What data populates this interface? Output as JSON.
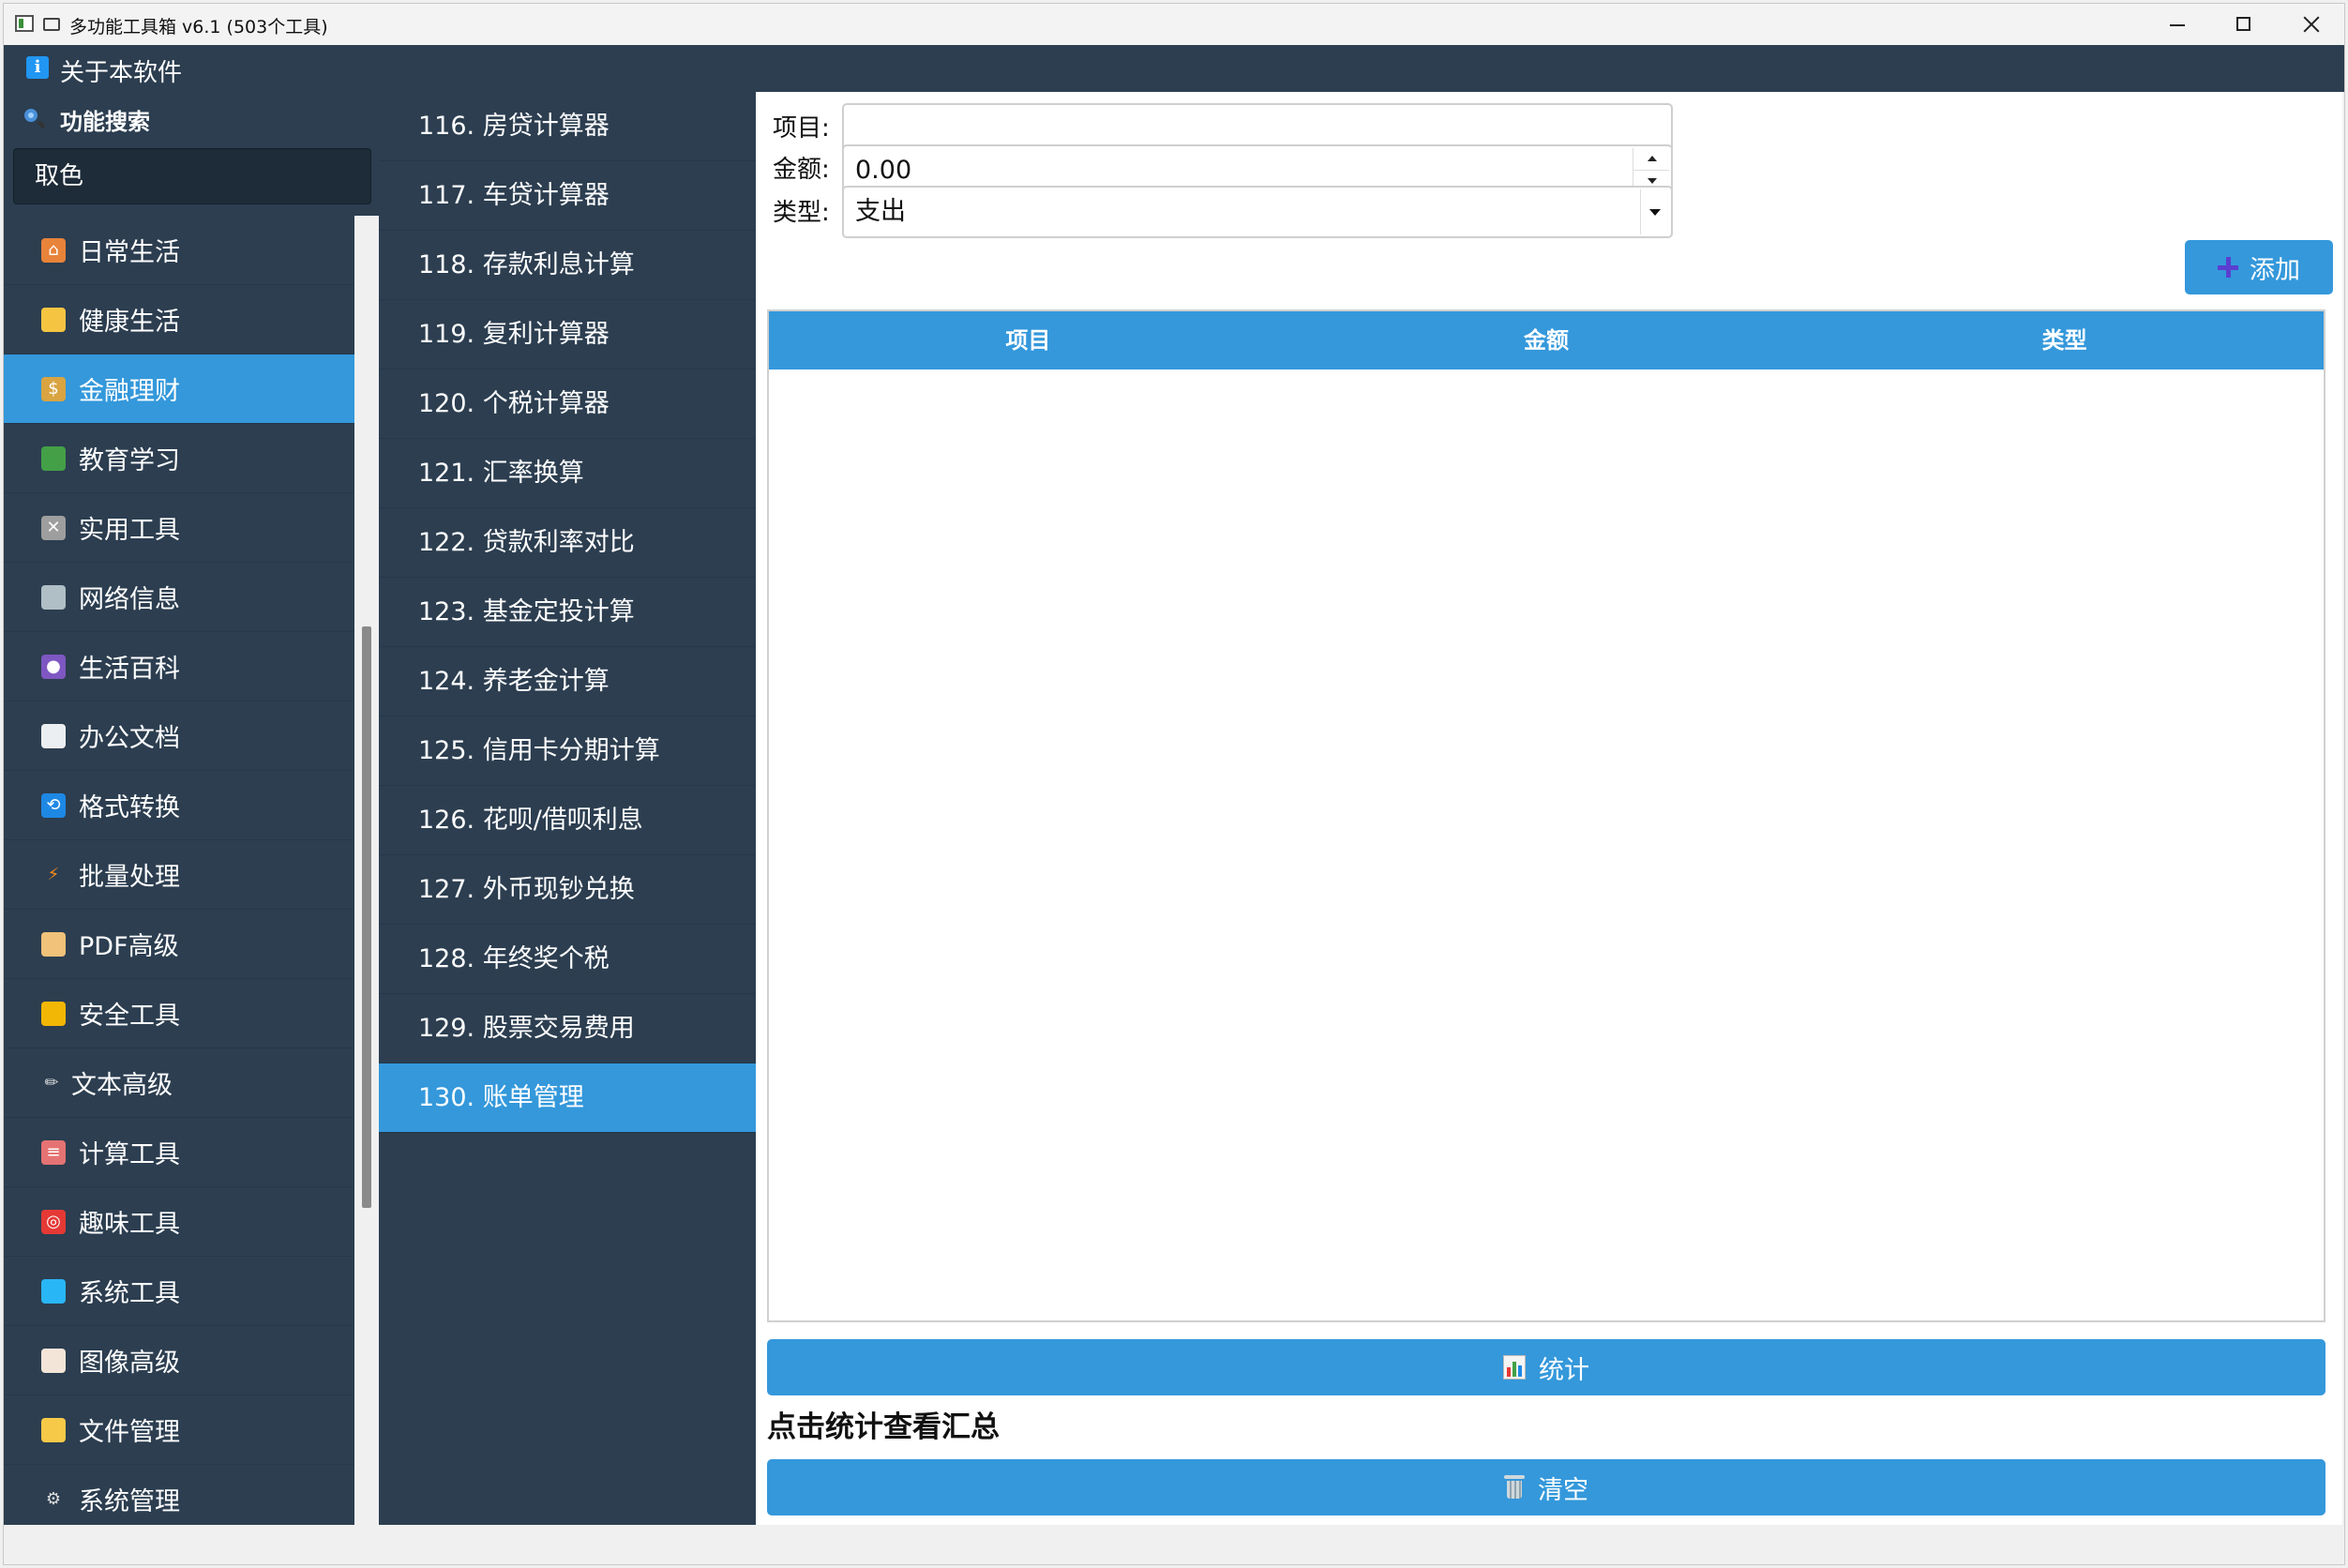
{
  "window": {
    "title": "多功能工具箱 v6.1 (503个工具)"
  },
  "menu": {
    "about": "关于本软件"
  },
  "search": {
    "label": "功能搜索",
    "value": "取色"
  },
  "categories": [
    {
      "label": "日常生活",
      "icon": "house-icon"
    },
    {
      "label": "健康生活",
      "icon": "flexed-arm-icon"
    },
    {
      "label": "金融理财",
      "icon": "money-bag-icon",
      "active": true
    },
    {
      "label": "教育学习",
      "icon": "books-icon"
    },
    {
      "label": "实用工具",
      "icon": "tools-icon"
    },
    {
      "label": "网络信息",
      "icon": "satellite-icon"
    },
    {
      "label": "生活百科",
      "icon": "bubble-icon"
    },
    {
      "label": "办公文档",
      "icon": "document-icon"
    },
    {
      "label": "格式转换",
      "icon": "repeat-icon"
    },
    {
      "label": "批量处理",
      "icon": "lightning-icon"
    },
    {
      "label": "PDF高级",
      "icon": "clipboard-icon"
    },
    {
      "label": "安全工具",
      "icon": "lock-icon"
    },
    {
      "label": "文本高级",
      "icon": "pencil-icon"
    },
    {
      "label": "计算工具",
      "icon": "abacus-icon"
    },
    {
      "label": "趣味工具",
      "icon": "target-icon"
    },
    {
      "label": "系统工具",
      "icon": "monitor-icon"
    },
    {
      "label": "图像高级",
      "icon": "palette-icon"
    },
    {
      "label": "文件管理",
      "icon": "folder-icon"
    },
    {
      "label": "系统管理",
      "icon": "gear-icon"
    }
  ],
  "tools": [
    "116. 房贷计算器",
    "117. 车贷计算器",
    "118. 存款利息计算",
    "119. 复利计算器",
    "120. 个税计算器",
    "121. 汇率换算",
    "122. 贷款利率对比",
    "123. 基金定投计算",
    "124. 养老金计算",
    "125. 信用卡分期计算",
    "126. 花呗/借呗利息",
    "127. 外币现钞兑换",
    "128. 年终奖个税",
    "129. 股票交易费用",
    "130. 账单管理"
  ],
  "form": {
    "item_label": "项目:",
    "item_value": "",
    "amount_label": "金额:",
    "amount_value": "0.00",
    "type_label": "类型:",
    "type_value": "支出",
    "add_label": "添加"
  },
  "table": {
    "columns": [
      "项目",
      "金额",
      "类型"
    ]
  },
  "buttons": {
    "stats": "统计",
    "clear": "清空"
  },
  "summary": "点击统计查看汇总",
  "colors": {
    "sidebar": "#2c3e50",
    "accent": "#3498db",
    "content": "#ffffff"
  }
}
